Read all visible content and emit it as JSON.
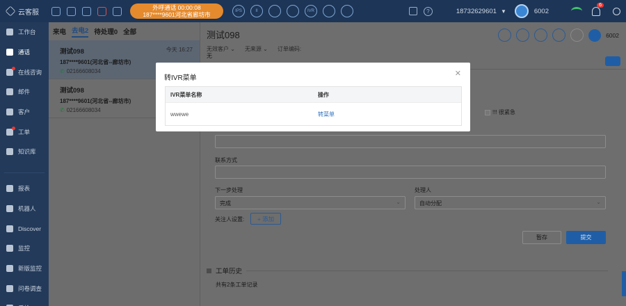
{
  "app": {
    "logo_text": "云客服"
  },
  "topbar": {
    "call_status_line1": "外呼通话    00:00:08",
    "call_status_line2": "187****9601河北省廊坊市",
    "round_buttons": [
      "IPS",
      "II",
      "",
      "",
      "IVR",
      "",
      ""
    ],
    "phone_number": "18732629601",
    "agent_id": "6002",
    "notification_count": "6"
  },
  "sidebar": {
    "items": [
      {
        "label": "工作台",
        "icon": "home-icon"
      },
      {
        "label": "通话",
        "icon": "phone-icon"
      },
      {
        "label": "在线咨询",
        "icon": "chat-icon"
      },
      {
        "label": "邮件",
        "icon": "mail-icon"
      },
      {
        "label": "客户",
        "icon": "user-icon"
      },
      {
        "label": "工单",
        "icon": "ticket-icon"
      },
      {
        "label": "知识库",
        "icon": "book-icon"
      },
      {
        "label": "报表",
        "icon": "report-icon"
      },
      {
        "label": "机器人",
        "icon": "robot-icon"
      },
      {
        "label": "Discover",
        "icon": "discover-icon"
      },
      {
        "label": "监控",
        "icon": "monitor-icon"
      },
      {
        "label": "新版监控",
        "icon": "monitor-new-icon"
      },
      {
        "label": "问卷调查",
        "icon": "survey-icon"
      },
      {
        "label": "质检",
        "icon": "shield-icon"
      }
    ]
  },
  "list": {
    "tabs": [
      "来电",
      "去电2",
      "待处理0",
      "全部"
    ],
    "active_tab": "去电2",
    "cards": [
      {
        "name": "测试098",
        "time": "今天 16:27",
        "caller": "187****9601(河北省--廊坊市)",
        "phone": "02166608034"
      },
      {
        "name": "测试098",
        "time": "",
        "caller": "187****9601(河北省--廊坊市)",
        "phone": "02166608034"
      }
    ]
  },
  "detail": {
    "title": "测试098",
    "meta": [
      "无效客户",
      "无来源",
      "订单编码:"
    ],
    "meta_value": "无",
    "agent_id": "6002",
    "urgent_label": "!!! 很紧急",
    "contact_label": "联系方式",
    "next_step_label": "下一步处理",
    "next_step_value": "完成",
    "handler_label": "处理人",
    "handler_value": "自动分配",
    "follower_label": "关注人设置:",
    "add_label": "+ 添加",
    "save_label": "暂存",
    "submit_label": "提交",
    "history_title": "工单历史",
    "history_sub": "共有2条工单记录"
  },
  "modal": {
    "title": "转IVR菜单",
    "columns": [
      "IVR菜单名称",
      "操作"
    ],
    "rows": [
      {
        "name": "wwewe",
        "action": "转菜单"
      }
    ]
  }
}
